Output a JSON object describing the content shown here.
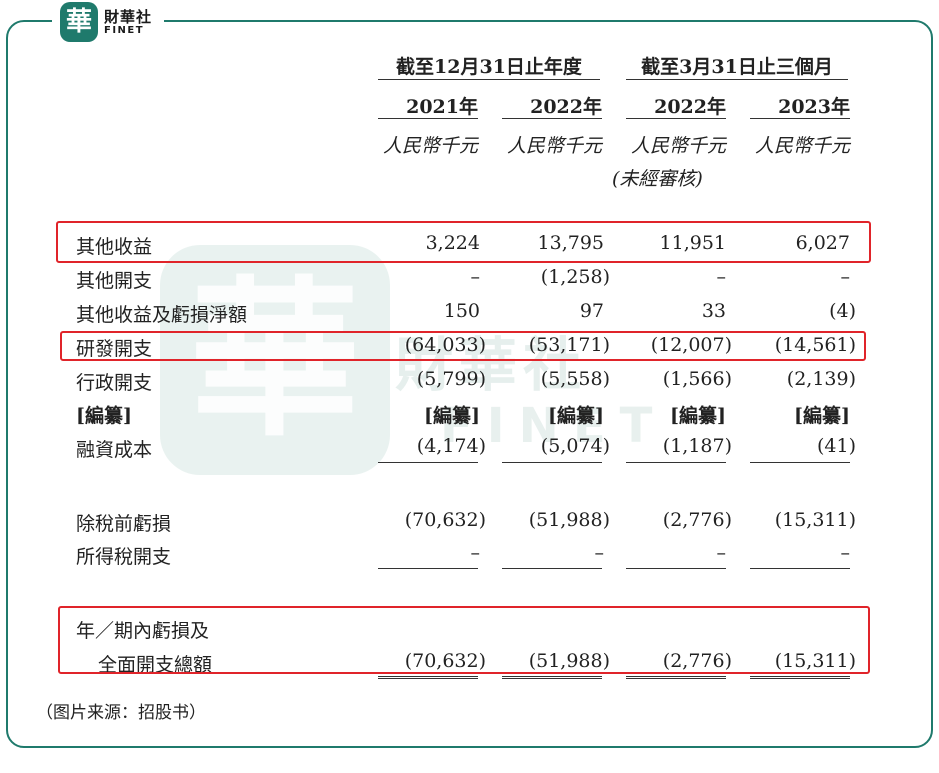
{
  "brand": {
    "mark": "華",
    "name_cn": "財華社",
    "name_en": "FINET"
  },
  "header": {
    "groups": [
      "截至12月31日止年度",
      "截至3月31日止三個月"
    ],
    "years": [
      "2021年",
      "2022年",
      "2022年",
      "2023年"
    ],
    "unit": "人民幣千元",
    "unaudited_note": "(未經審核)"
  },
  "rows": [
    {
      "label": "其他收益",
      "values": [
        "3,224",
        "13,795",
        "11,951",
        "6,027"
      ]
    },
    {
      "label": "其他開支",
      "values": [
        "–",
        "(1,258)",
        "–",
        "–"
      ]
    },
    {
      "label": "其他收益及虧損淨額",
      "values": [
        "150",
        "97",
        "33",
        "(4)"
      ]
    },
    {
      "label": "研發開支",
      "values": [
        "(64,033)",
        "(53,171)",
        "(12,007)",
        "(14,561)"
      ]
    },
    {
      "label": "行政開支",
      "values": [
        "(5,799)",
        "(5,558)",
        "(1,566)",
        "(2,139)"
      ]
    },
    {
      "label": "[編纂]",
      "values": [
        "[編纂]",
        "[編纂]",
        "[編纂]",
        "[編纂]"
      ]
    },
    {
      "label": "融資成本",
      "values": [
        "(4,174)",
        "(5,074)",
        "(1,187)",
        "(41)"
      ]
    },
    {
      "label": "除稅前虧損",
      "values": [
        "(70,632)",
        "(51,988)",
        "(2,776)",
        "(15,311)"
      ]
    },
    {
      "label": "所得稅開支",
      "values": [
        "–",
        "–",
        "–",
        "–"
      ]
    },
    {
      "label": "年／期內虧損及",
      "values": [
        "",
        "",
        "",
        ""
      ]
    },
    {
      "label": "全面開支總額",
      "values": [
        "(70,632)",
        "(51,988)",
        "(2,776)",
        "(15,311)"
      ]
    }
  ],
  "source": "（图片来源：招股书）"
}
